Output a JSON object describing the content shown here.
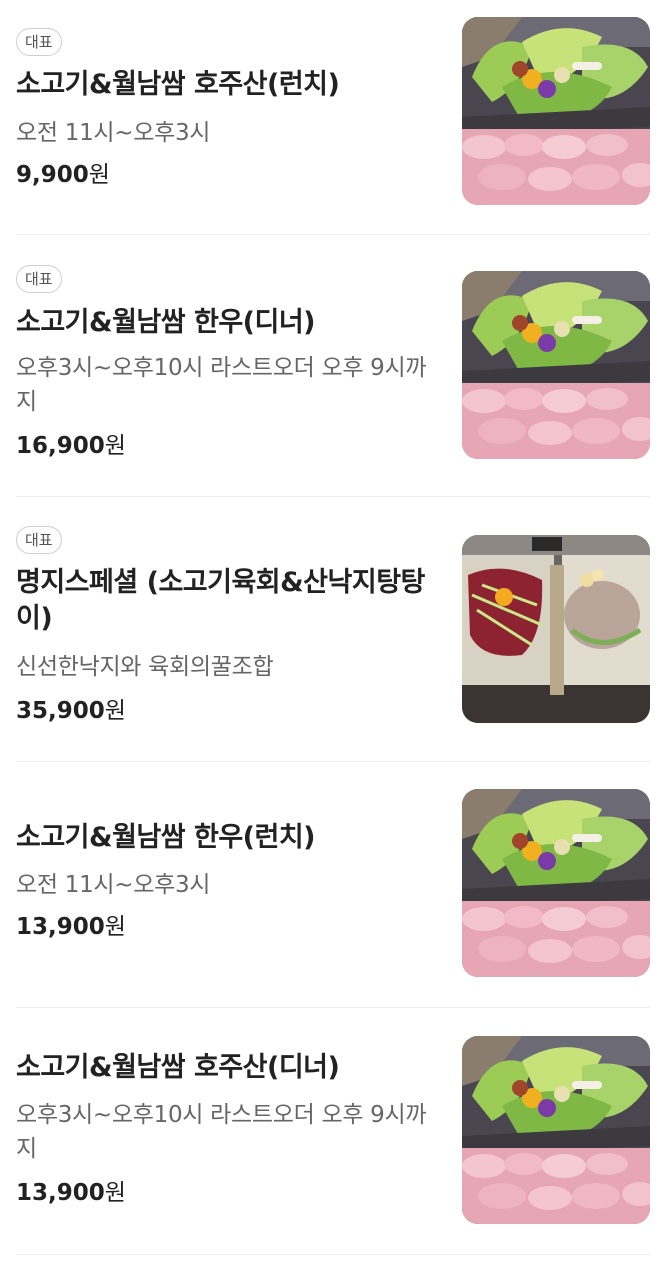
{
  "badge_label": "대표",
  "currency": "원",
  "menu_items": [
    {
      "title": "소고기&월남쌈 호주산(런치)",
      "description": "오전 11시~오후3시",
      "price": "9,900",
      "has_badge": true,
      "photo": "beef-wrap-platter"
    },
    {
      "title": "소고기&월남쌈 한우(디너)",
      "description": "오후3시~오후10시 라스트오더 오후 9시까지",
      "price": "16,900",
      "has_badge": true,
      "photo": "beef-wrap-platter"
    },
    {
      "title": "명지스페셜 (소고기육회&산낙지탕탕이)",
      "description": "신선한낙지와 육회의꿀조합",
      "price": "35,900",
      "has_badge": true,
      "photo": "yukhoe-octopus-platter"
    },
    {
      "title": "소고기&월남쌈 한우(런치)",
      "description": "오전 11시~오후3시",
      "price": "13,900",
      "has_badge": false,
      "photo": "beef-wrap-platter"
    },
    {
      "title": "소고기&월남쌈 호주산(디너)",
      "description": "오후3시~오후10시 라스트오더 오후 9시까지",
      "price": "13,900",
      "has_badge": false,
      "photo": "beef-wrap-platter"
    }
  ]
}
